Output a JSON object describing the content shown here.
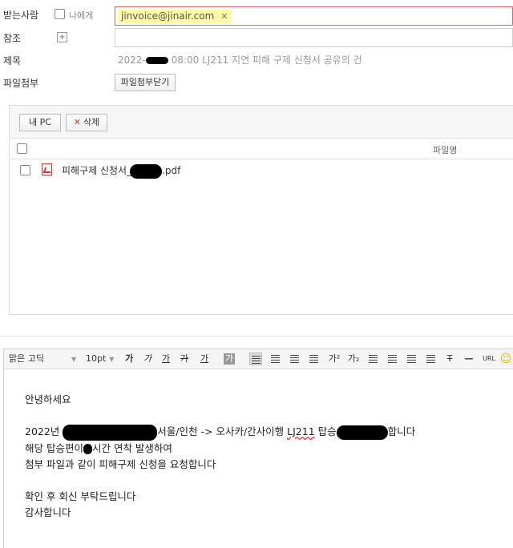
{
  "header": {
    "to_label": "받는사람",
    "self_label": "나에게",
    "to_recipient": "jinvoice@jinair.com",
    "remove_symbol": "✕",
    "cc_label": "참조",
    "cc_add_symbol": "+",
    "subject_label": "제목",
    "subject_prefix": "2022-",
    "subject_suffix": "08:00 LJ211 지연 피해 구제 신청서 공유의 건",
    "attachment_label": "파일첨부",
    "attachment_close_btn": "파일첨부닫기"
  },
  "attachments": {
    "mypc_btn": "내 PC",
    "delete_btn": "삭제",
    "delete_symbol": "✕",
    "column_filename": "파일명",
    "files": [
      {
        "name_prefix": "피해구제 신청서_",
        "name_suffix": ".pdf"
      }
    ]
  },
  "editor": {
    "toolbar": {
      "font": "맑은 고딕",
      "size": "10pt",
      "bold": "가",
      "italic": "가",
      "underline": "가",
      "strike": "가",
      "color": "가",
      "bgcolor": "가",
      "superscript": "가²",
      "subscript": "가₂",
      "url": "URL"
    },
    "body": {
      "line1": "안녕하세요",
      "line2_prefix": "2022년",
      "line2_mid": "서울/인천 -> 오사카/간사이행",
      "line2_flight": "LJ211",
      "line2_board": "탑승",
      "line2_suffix": "합니다",
      "line3_prefix": "해당 탑승편이",
      "line3_suffix": "시간 연착 발생하여",
      "line4": "첨부 파일과 같이 피해구제 신청을 요청합니다",
      "line5": "확인 후 회신 부탁드립니다",
      "line6": "감사합니다"
    }
  }
}
